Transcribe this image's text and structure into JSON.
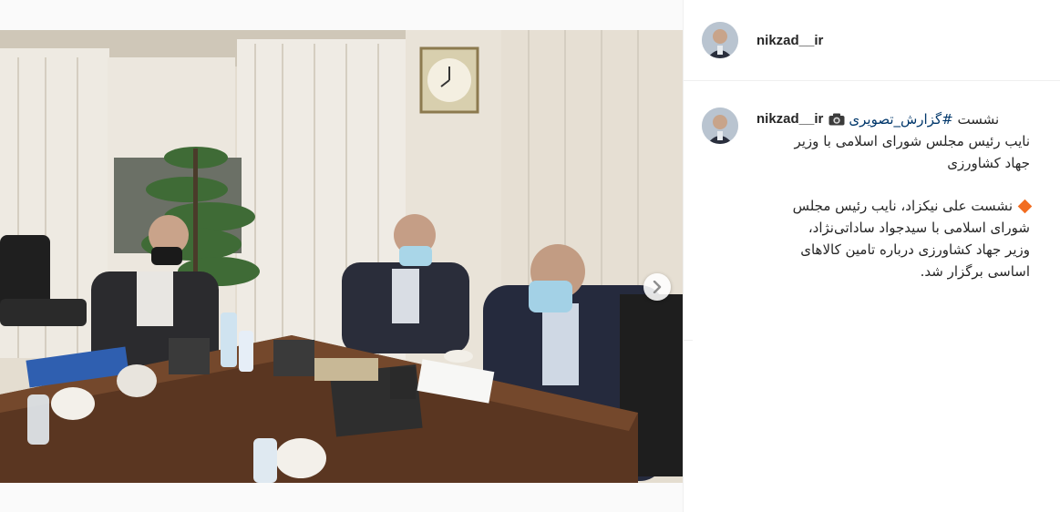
{
  "post": {
    "username": "nikzad__ir",
    "caption": {
      "username": "nikzad__ir",
      "hashtag": "#گزارش_تصویری",
      "word_after_tag": "نشست",
      "line_2": "نایب رئیس مجلس شورای اسلامی با وزیر",
      "line_3": "جهاد کشاورزی",
      "para_1": "نشست علی نیکزاد، نایب رئیس مجلس",
      "para_2": "شورای اسلامی با سیدجواد ساداتی‌نژاد،",
      "para_3": "وزیر جهاد کشاورزی درباره تامین کالاهای",
      "para_4": "اساسی برگزار شد."
    },
    "carousel": {
      "count": 3,
      "active_index": 0
    }
  },
  "colors": {
    "hashtag": "#00376b",
    "diamond": "#f26d21",
    "active_dot": "#3897f0"
  },
  "icons": {
    "camera": "camera-emoji-icon",
    "bullet": "orange-diamond-icon",
    "next": "chevron-right-icon"
  }
}
